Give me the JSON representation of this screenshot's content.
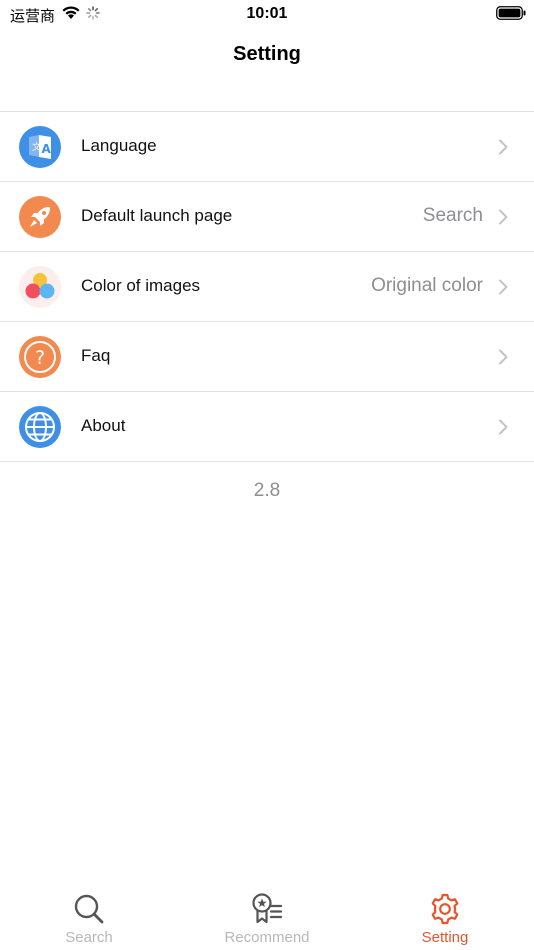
{
  "status_bar": {
    "carrier": "运营商",
    "time": "10:01"
  },
  "nav": {
    "title": "Setting"
  },
  "settings": {
    "items": [
      {
        "label": "Language",
        "value": "",
        "icon": "translate-icon"
      },
      {
        "label": "Default launch page",
        "value": "Search",
        "icon": "rocket-icon"
      },
      {
        "label": "Color of images",
        "value": "Original color",
        "icon": "color-dots-icon"
      },
      {
        "label": "Faq",
        "value": "",
        "icon": "question-icon"
      },
      {
        "label": "About",
        "value": "",
        "icon": "globe-icon"
      }
    ],
    "version": "2.8"
  },
  "tab_bar": {
    "tabs": [
      {
        "label": "Search",
        "icon": "search-icon",
        "active": false
      },
      {
        "label": "Recommend",
        "icon": "recommend-icon",
        "active": false
      },
      {
        "label": "Setting",
        "icon": "gear-icon",
        "active": true
      }
    ]
  },
  "colors": {
    "accent": "#e8552d",
    "blue_icon": "#3f8fe6",
    "orange_icon": "#f2894e",
    "secondary_text": "#8e8e93",
    "inactive_tab": "#b8b8b8"
  }
}
